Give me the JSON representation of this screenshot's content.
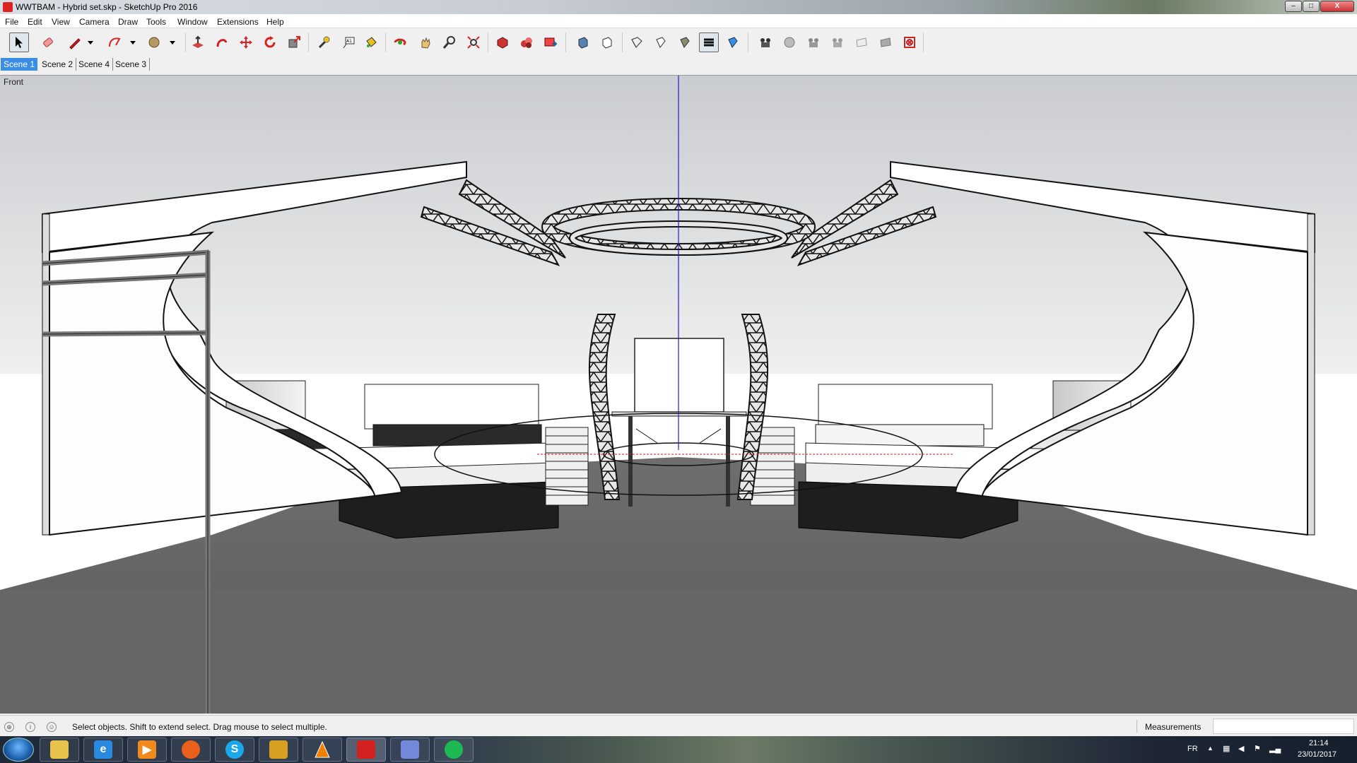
{
  "window": {
    "title": "WWTBAM - Hybrid set.skp - SketchUp Pro 2016",
    "controls": [
      "–",
      "□",
      "X"
    ]
  },
  "menu": [
    "File",
    "Edit",
    "View",
    "Camera",
    "Draw",
    "Tools",
    "Window",
    "Extensions",
    "Help"
  ],
  "toolbar": {
    "tools": [
      {
        "icon": "select-arrow-icon",
        "active": true
      },
      {
        "icon": "eraser-icon"
      },
      {
        "icon": "pencil-line-icon"
      },
      {
        "icon": "dropdown-arrow-icon"
      },
      {
        "icon": "freehand-arc-icon"
      },
      {
        "icon": "dropdown-arrow-icon"
      },
      {
        "icon": "circle-shape-icon"
      },
      {
        "icon": "dropdown-arrow-icon"
      },
      {
        "icon": "push-pull-icon"
      },
      {
        "icon": "follow-me-icon"
      },
      {
        "icon": "move-icon"
      },
      {
        "icon": "rotate-icon"
      },
      {
        "icon": "scale-icon"
      },
      {
        "icon": "tape-measure-icon"
      },
      {
        "icon": "text-label-icon"
      },
      {
        "icon": "paint-bucket-icon"
      },
      {
        "icon": "orbit-icon"
      },
      {
        "icon": "pan-hand-icon"
      },
      {
        "icon": "zoom-icon"
      },
      {
        "icon": "zoom-extents-icon"
      },
      {
        "icon": "3d-warehouse-icon"
      },
      {
        "icon": "extension-warehouse-icon"
      },
      {
        "icon": "send-to-layout-icon"
      },
      {
        "icon": "xray-style-icon"
      },
      {
        "icon": "wireframe-style-icon"
      },
      {
        "icon": "hidden-line-style-icon"
      },
      {
        "icon": "shaded-style-icon"
      },
      {
        "icon": "shaded-textures-style-icon",
        "active": true
      },
      {
        "icon": "monochrome-style-icon"
      },
      {
        "icon": "position-camera-icon"
      },
      {
        "icon": "look-around-icon"
      },
      {
        "icon": "walk-icon"
      },
      {
        "icon": "section-plane-icon"
      },
      {
        "icon": "display-section-planes-icon"
      },
      {
        "icon": "display-section-cuts-icon"
      },
      {
        "icon": "sandbox-icon"
      }
    ]
  },
  "scenes": [
    {
      "label": "Scene 1",
      "active": true
    },
    {
      "label": "Scene 2"
    },
    {
      "label": "Scene 4"
    },
    {
      "label": "Scene 3"
    }
  ],
  "viewport": {
    "view_label": "Front"
  },
  "statusbar": {
    "message": "Select objects. Shift to extend select. Drag mouse to select multiple.",
    "measurements_label": "Measurements",
    "measurements_value": ""
  },
  "taskbar": {
    "apps": [
      {
        "name": "file-explorer-icon",
        "color": "#e8c24a"
      },
      {
        "name": "internet-explorer-icon",
        "color": "#2a8ae0"
      },
      {
        "name": "media-player-icon",
        "color": "#f08a1c"
      },
      {
        "name": "firefox-icon",
        "color": "#e8601c"
      },
      {
        "name": "skype-icon",
        "color": "#1aa7ec"
      },
      {
        "name": "game-app-icon",
        "color": "#d8a020"
      },
      {
        "name": "vlc-icon",
        "color": "#f08000"
      },
      {
        "name": "sketchup-icon",
        "color": "#d32020"
      },
      {
        "name": "discord-icon",
        "color": "#7289da"
      },
      {
        "name": "spotify-icon",
        "color": "#1db954"
      }
    ],
    "tray": {
      "language": "FR",
      "time": "21:14",
      "date": "23/01/2017"
    }
  }
}
